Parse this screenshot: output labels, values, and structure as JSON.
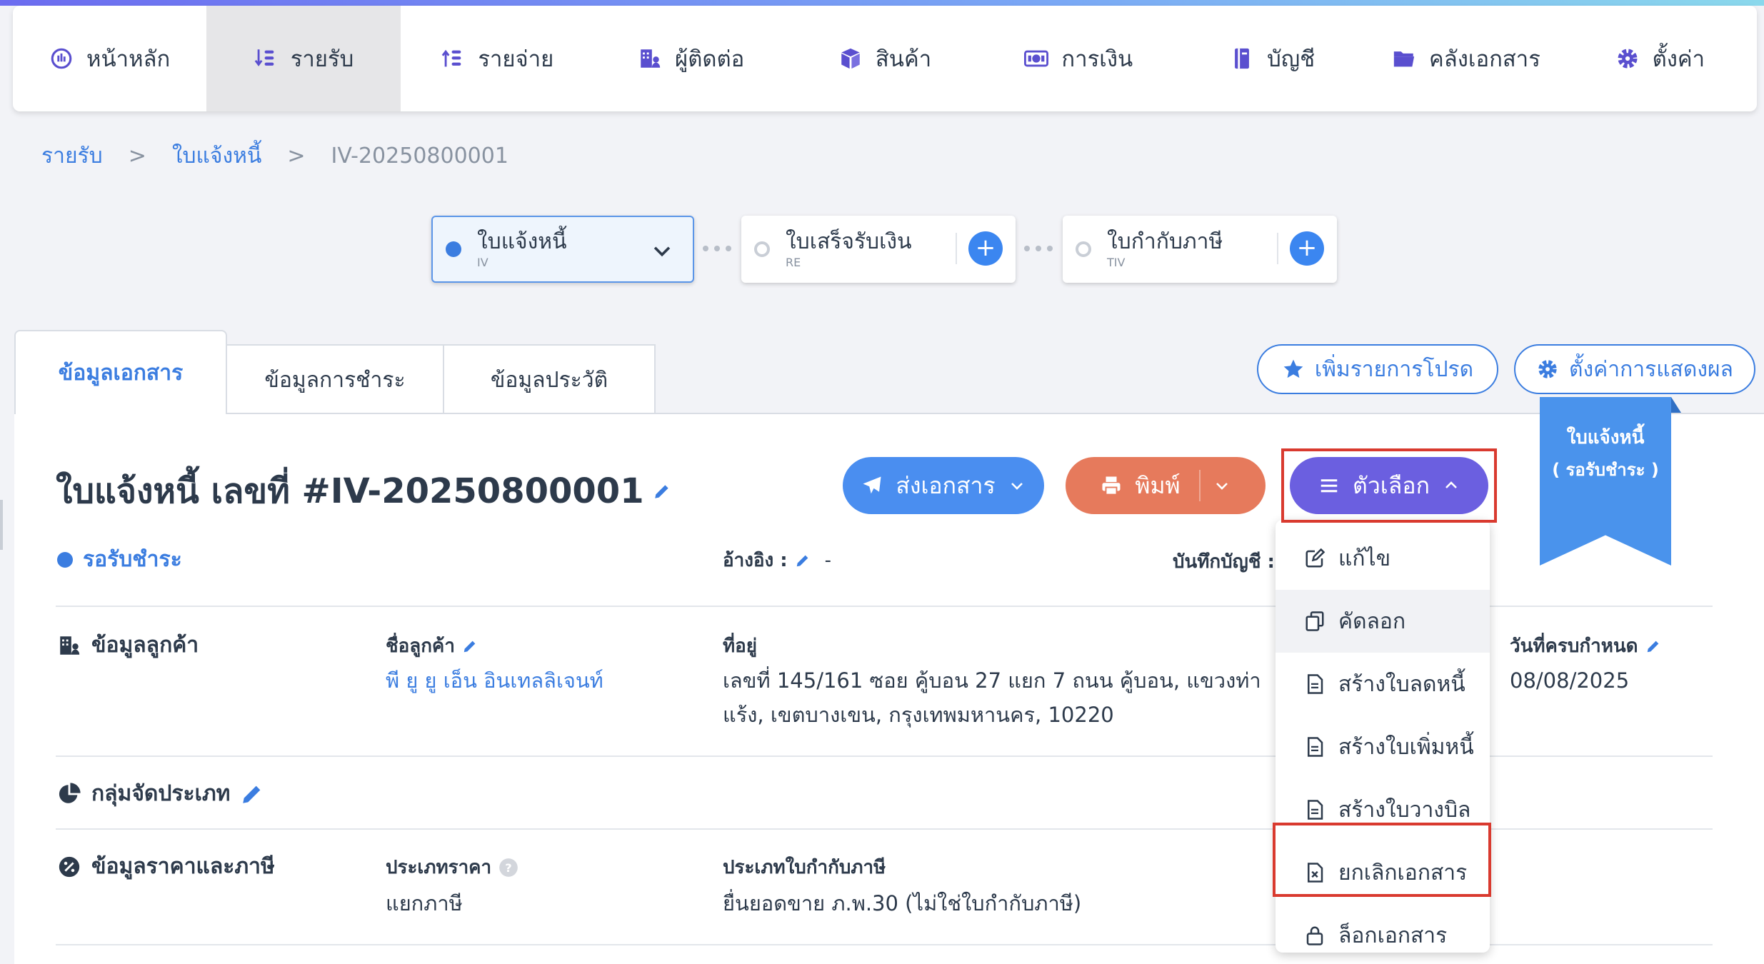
{
  "nav": {
    "items": [
      {
        "label": "หน้าหลัก",
        "icon": "dashboard-icon"
      },
      {
        "label": "รายรับ",
        "icon": "income-icon"
      },
      {
        "label": "รายจ่าย",
        "icon": "expense-icon"
      },
      {
        "label": "ผู้ติดต่อ",
        "icon": "contacts-icon"
      },
      {
        "label": "สินค้า",
        "icon": "product-box-icon"
      },
      {
        "label": "การเงิน",
        "icon": "money-icon"
      },
      {
        "label": "บัญชี",
        "icon": "book-icon"
      },
      {
        "label": "คลังเอกสาร",
        "icon": "folder-icon"
      },
      {
        "label": "ตั้งค่า",
        "icon": "gear-icon"
      }
    ],
    "active_index": 1
  },
  "breadcrumb": {
    "level1": "รายรับ",
    "level2": "ใบแจ้งหนี้",
    "current": "IV-20250800001",
    "separator": ">"
  },
  "flow": {
    "step1": {
      "title": "ใบแจ้งหนี้",
      "code": "IV"
    },
    "step2": {
      "title": "ใบเสร็จรับเงิน",
      "code": "RE"
    },
    "step3": {
      "title": "ใบกำกับภาษี",
      "code": "TIV"
    },
    "plus": "+"
  },
  "tabs": {
    "doc_info": "ข้อมูลเอกสาร",
    "payment_info": "ข้อมูลการชำระ",
    "history": "ข้อมูลประวัติ"
  },
  "actions": {
    "favorite": "เพิ่มรายการโปรด",
    "display_settings": "ตั้งค่าการแสดงผล",
    "send": "ส่งเอกสาร",
    "print": "พิมพ์",
    "options": "ตัวเลือก"
  },
  "ribbon": {
    "line1": "ใบแจ้งหนี้",
    "line2": "( รอรับชำระ )"
  },
  "document": {
    "title": "ใบแจ้งหนี้ เลขที่ #IV-20250800001",
    "status": "รอรับชำระ",
    "reference_label": "อ้างอิง :",
    "reference_value": "-",
    "account_label": "บันทึกบัญชี :"
  },
  "customer": {
    "section_title": "ข้อมูลลูกค้า",
    "name_label": "ชื่อลูกค้า",
    "name_value": "พี ยู ยู เอ็น อินเทลลิเจนท์",
    "address_label": "ที่อยู่",
    "address_line1": "เลขที่ 145/161 ซอย คู้บอน 27 แยก 7 ถนน คู้บอน, แขวงท่า",
    "address_line2": "แร้ง, เขตบางเขน, กรุงเทพมหานคร, 10220",
    "due_label": "วันที่ครบกำหนด",
    "due_value": "08/08/2025"
  },
  "category": {
    "section_title": "กลุ่มจัดประเภท"
  },
  "pricing": {
    "section_title": "ข้อมูลราคาและภาษี",
    "price_type_label": "ประเภทราคา",
    "price_type_value": "แยกภาษี",
    "tax_invoice_label": "ประเภทใบกำกับภาษี",
    "tax_invoice_value": "ยื่นยอดขาย ภ.พ.30 (ไม่ใช่ใบกำกับภาษี)"
  },
  "dropdown": {
    "items": [
      {
        "label": "แก้ไข",
        "icon": "edit-icon"
      },
      {
        "label": "คัดลอก",
        "icon": "copy-icon"
      },
      {
        "label": "สร้างใบลดหนี้",
        "icon": "document-icon"
      },
      {
        "label": "สร้างใบเพิ่มหนี้",
        "icon": "document-icon"
      },
      {
        "label": "สร้างใบวางบิล",
        "icon": "document-icon"
      },
      {
        "label": "ยกเลิกเอกสาร",
        "icon": "cancel-document-icon"
      },
      {
        "label": "ล็อกเอกสาร",
        "icon": "lock-icon"
      }
    ]
  },
  "colors": {
    "accent_blue": "#3b7de0",
    "send_button": "#4a8ef0",
    "print_button": "#e67a5c",
    "options_button": "#6b5fe0",
    "highlight_red": "#d93a2f",
    "ribbon": "#4a93ec"
  }
}
